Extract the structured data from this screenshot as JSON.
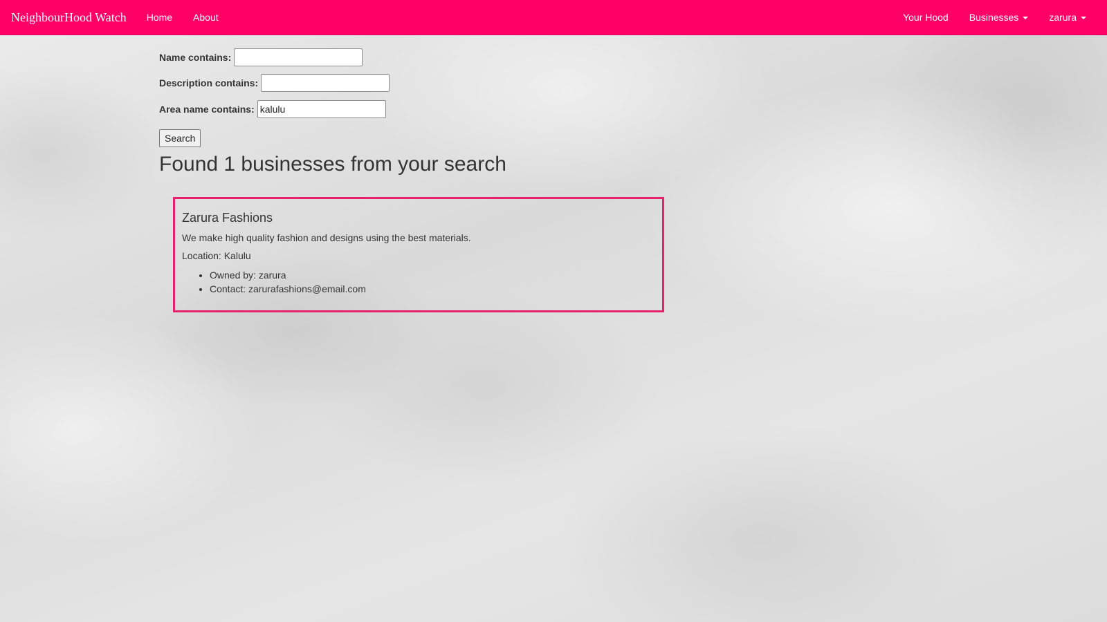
{
  "navbar": {
    "brand": "NeighbourHood Watch",
    "links": [
      "Home",
      "About"
    ],
    "right": {
      "your_hood": "Your Hood",
      "businesses": "Businesses",
      "user": "zarura"
    },
    "color": "#ff0066"
  },
  "search_form": {
    "name_label": "Name contains:",
    "name_value": "",
    "description_label": "Description contains:",
    "description_value": "",
    "area_label": "Area name contains:",
    "area_value": "kalulu",
    "search_button": "Search"
  },
  "results": {
    "heading": "Found 1 businesses from your search",
    "items": [
      {
        "name": "Zarura Fashions",
        "description": "We make high quality fashion and designs using the best materials.",
        "location": "Location: Kalulu",
        "owned_by": "Owned by: zarura",
        "contact": "Contact: zarurafashions@email.com"
      }
    ],
    "card_border_color": "#e6226e"
  }
}
